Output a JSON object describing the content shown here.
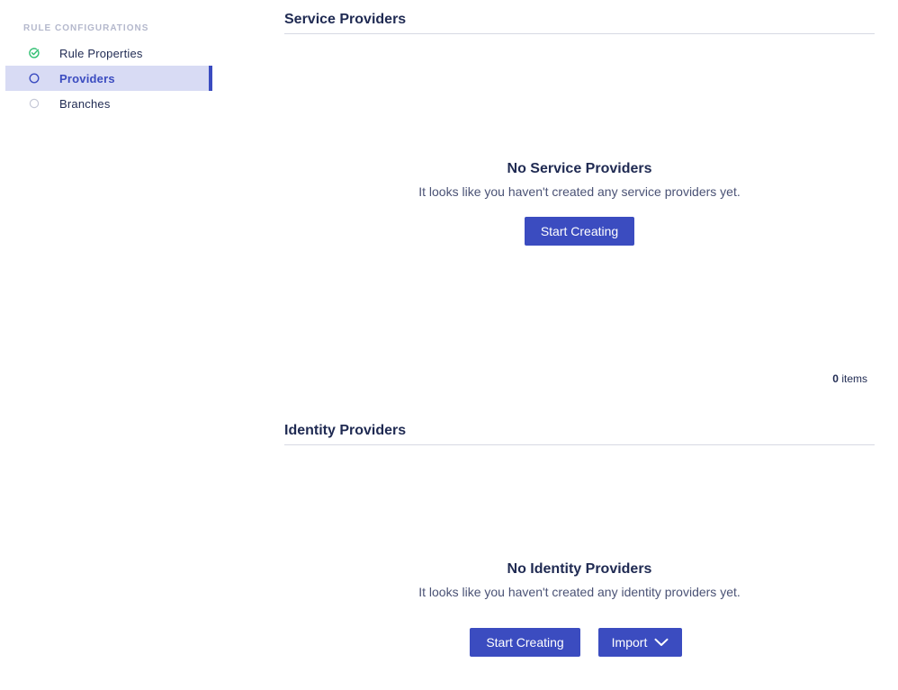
{
  "sidebar": {
    "heading": "RULE CONFIGURATIONS",
    "items": [
      {
        "label": "Rule Properties",
        "icon": "check-circle-icon",
        "state": "complete"
      },
      {
        "label": "Providers",
        "icon": "circle-icon",
        "state": "active"
      },
      {
        "label": "Branches",
        "icon": "circle-icon",
        "state": "pending"
      }
    ]
  },
  "service_providers": {
    "title": "Service Providers",
    "empty_title": "No Service Providers",
    "empty_desc": "It looks like you haven't created any service providers yet.",
    "create_label": "Start Creating",
    "count": "0",
    "count_suffix": " items"
  },
  "identity_providers": {
    "title": "Identity Providers",
    "empty_title": "No Identity Providers",
    "empty_desc": "It looks like you haven't created any identity providers yet.",
    "create_label": "Start Creating",
    "import_label": "Import"
  },
  "colors": {
    "accent": "#3b4cc0",
    "active_bg": "#d8dbf4",
    "success": "#2fbf71",
    "text": "#1f2a52"
  }
}
